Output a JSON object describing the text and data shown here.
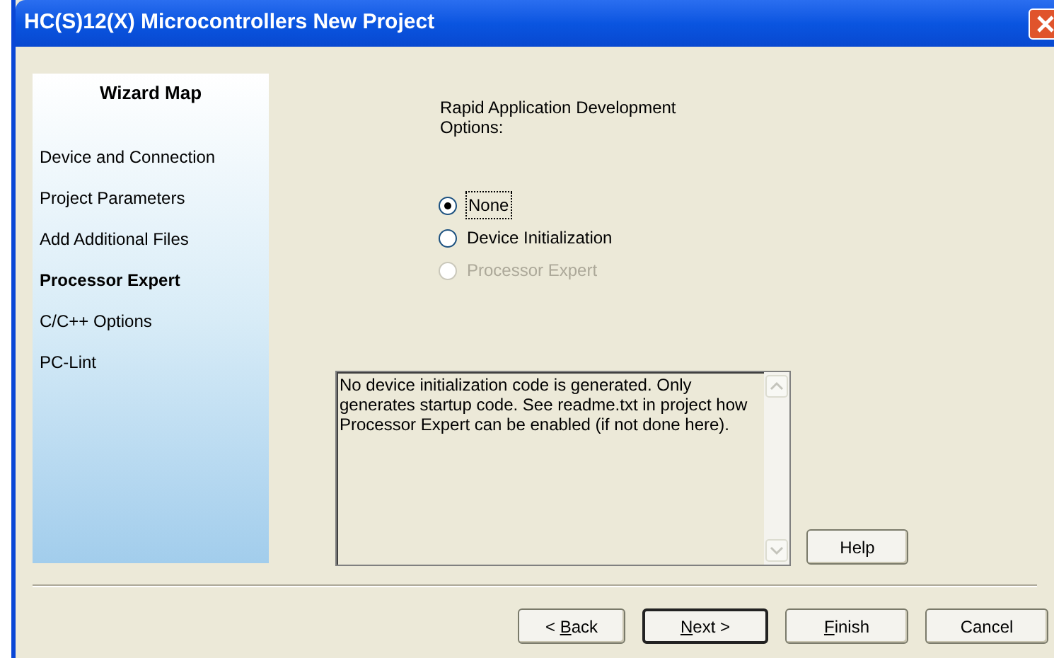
{
  "window": {
    "title": "HC(S)12(X) Microcontrollers New Project"
  },
  "wizard_map": {
    "title": "Wizard Map",
    "items": [
      {
        "label": "Device and Connection",
        "selected": false
      },
      {
        "label": "Project Parameters",
        "selected": false
      },
      {
        "label": "Add Additional Files",
        "selected": false
      },
      {
        "label": "Processor Expert",
        "selected": true
      },
      {
        "label": "C/C++ Options",
        "selected": false
      },
      {
        "label": "PC-Lint",
        "selected": false
      }
    ]
  },
  "options": {
    "label": "Rapid Application Development Options:",
    "radios": [
      {
        "label": "None",
        "selected": true,
        "disabled": false
      },
      {
        "label": "Device Initialization",
        "selected": false,
        "disabled": false
      },
      {
        "label": "Processor Expert",
        "selected": false,
        "disabled": true
      }
    ]
  },
  "description": "No device initialization code is generated. Only generates startup code. See readme.txt in project how Processor Expert can be enabled (if not done here).",
  "help_button": "Help",
  "buttons": [
    {
      "before": "< ",
      "key": "B",
      "after": "ack",
      "default": false
    },
    {
      "key": "N",
      "after": "ext >",
      "default": true
    },
    {
      "key": "F",
      "after": "inish",
      "default": false
    },
    {
      "before": "Cancel",
      "default": false
    }
  ]
}
